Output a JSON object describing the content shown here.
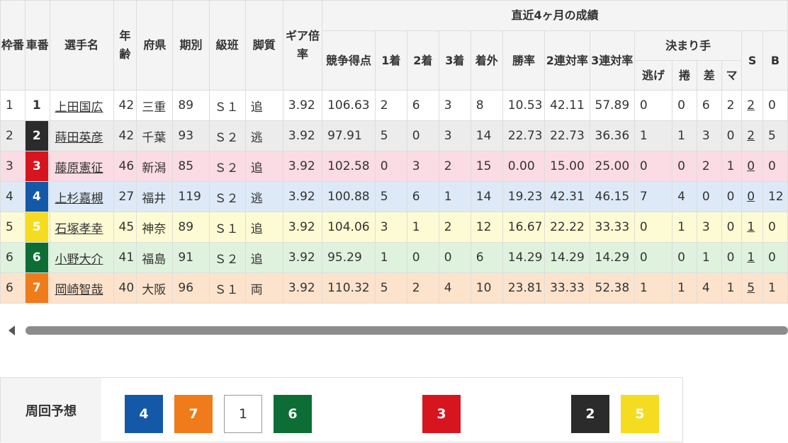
{
  "header": {
    "waku": "枠番",
    "sha": "車番",
    "name": "選手名",
    "age": "年齢",
    "pref": "府県",
    "term": "期別",
    "class": "級班",
    "style": "脚質",
    "gear": "ギア倍率",
    "recent": "直近4ヶ月の成績",
    "score": "競争得点",
    "first": "1着",
    "second": "2着",
    "third": "3着",
    "out": "着外",
    "win_rate": "勝率",
    "ren2": "2連対率",
    "ren3": "3連対率",
    "kimarite": "決まり手",
    "nige": "逃げ",
    "makuri": "捲",
    "sashi": "差",
    "mark": "マ",
    "s": "S",
    "b": "B"
  },
  "riders": [
    {
      "waku": "1",
      "car": "1",
      "name": "上田国広",
      "age": "42",
      "pref": "三重",
      "term": "89",
      "class": "Ｓ１",
      "style": "追",
      "gear": "3.92",
      "score": "106.63",
      "first": "2",
      "second": "6",
      "third": "3",
      "out": "8",
      "win_rate": "10.53",
      "ren2": "42.11",
      "ren3": "57.89",
      "nige": "0",
      "makuri": "0",
      "sashi": "6",
      "mark": "2",
      "s": "2",
      "b": "0"
    },
    {
      "waku": "2",
      "car": "2",
      "name": "蒔田英彦",
      "age": "42",
      "pref": "千葉",
      "term": "93",
      "class": "Ｓ２",
      "style": "逃",
      "gear": "3.92",
      "score": "97.91",
      "first": "5",
      "second": "0",
      "third": "3",
      "out": "14",
      "win_rate": "22.73",
      "ren2": "22.73",
      "ren3": "36.36",
      "nige": "1",
      "makuri": "1",
      "sashi": "3",
      "mark": "0",
      "s": "2",
      "b": "5"
    },
    {
      "waku": "3",
      "car": "3",
      "name": "藤原憲征",
      "age": "46",
      "pref": "新潟",
      "term": "85",
      "class": "Ｓ２",
      "style": "追",
      "gear": "3.92",
      "score": "102.58",
      "first": "0",
      "second": "3",
      "third": "2",
      "out": "15",
      "win_rate": "0.00",
      "ren2": "15.00",
      "ren3": "25.00",
      "nige": "0",
      "makuri": "0",
      "sashi": "2",
      "mark": "1",
      "s": "0",
      "b": "0"
    },
    {
      "waku": "4",
      "car": "4",
      "name": "上杉嘉槻",
      "age": "27",
      "pref": "福井",
      "term": "119",
      "class": "Ｓ２",
      "style": "逃",
      "gear": "3.92",
      "score": "100.88",
      "first": "5",
      "second": "6",
      "third": "1",
      "out": "14",
      "win_rate": "19.23",
      "ren2": "42.31",
      "ren3": "46.15",
      "nige": "7",
      "makuri": "4",
      "sashi": "0",
      "mark": "0",
      "s": "0",
      "b": "12"
    },
    {
      "waku": "5",
      "car": "5",
      "name": "石塚孝幸",
      "age": "45",
      "pref": "神奈",
      "term": "89",
      "class": "Ｓ１",
      "style": "追",
      "gear": "3.92",
      "score": "104.06",
      "first": "3",
      "second": "1",
      "third": "2",
      "out": "12",
      "win_rate": "16.67",
      "ren2": "22.22",
      "ren3": "33.33",
      "nige": "0",
      "makuri": "1",
      "sashi": "3",
      "mark": "0",
      "s": "1",
      "b": "0"
    },
    {
      "waku": "6",
      "car": "6",
      "name": "小野大介",
      "age": "41",
      "pref": "福島",
      "term": "91",
      "class": "Ｓ２",
      "style": "追",
      "gear": "3.92",
      "score": "95.29",
      "first": "1",
      "second": "0",
      "third": "0",
      "out": "6",
      "win_rate": "14.29",
      "ren2": "14.29",
      "ren3": "14.29",
      "nige": "0",
      "makuri": "0",
      "sashi": "1",
      "mark": "0",
      "s": "1",
      "b": "0"
    },
    {
      "waku": "6",
      "car": "7",
      "name": "岡崎智哉",
      "age": "40",
      "pref": "大阪",
      "term": "96",
      "class": "Ｓ１",
      "style": "両",
      "gear": "3.92",
      "score": "110.32",
      "first": "5",
      "second": "2",
      "third": "4",
      "out": "10",
      "win_rate": "23.81",
      "ren2": "33.33",
      "ren3": "52.38",
      "nige": "1",
      "makuri": "1",
      "sashi": "4",
      "mark": "1",
      "s": "5",
      "b": "1"
    }
  ],
  "car_colors": [
    {
      "bg": "#ffffff",
      "fg": "#333333"
    },
    {
      "bg": "#2b2b2b",
      "fg": "#ffffff"
    },
    {
      "bg": "#d7151f",
      "fg": "#ffffff"
    },
    {
      "bg": "#1359a8",
      "fg": "#ffffff"
    },
    {
      "bg": "#f5dc20",
      "fg": "#ffffff"
    },
    {
      "bg": "#0c6e34",
      "fg": "#ffffff"
    },
    {
      "bg": "#ef7b1a",
      "fg": "#ffffff"
    }
  ],
  "forecast": {
    "label": "周回予想",
    "cars": [
      "4",
      "7",
      "1",
      "6",
      "3",
      "2",
      "5"
    ]
  }
}
